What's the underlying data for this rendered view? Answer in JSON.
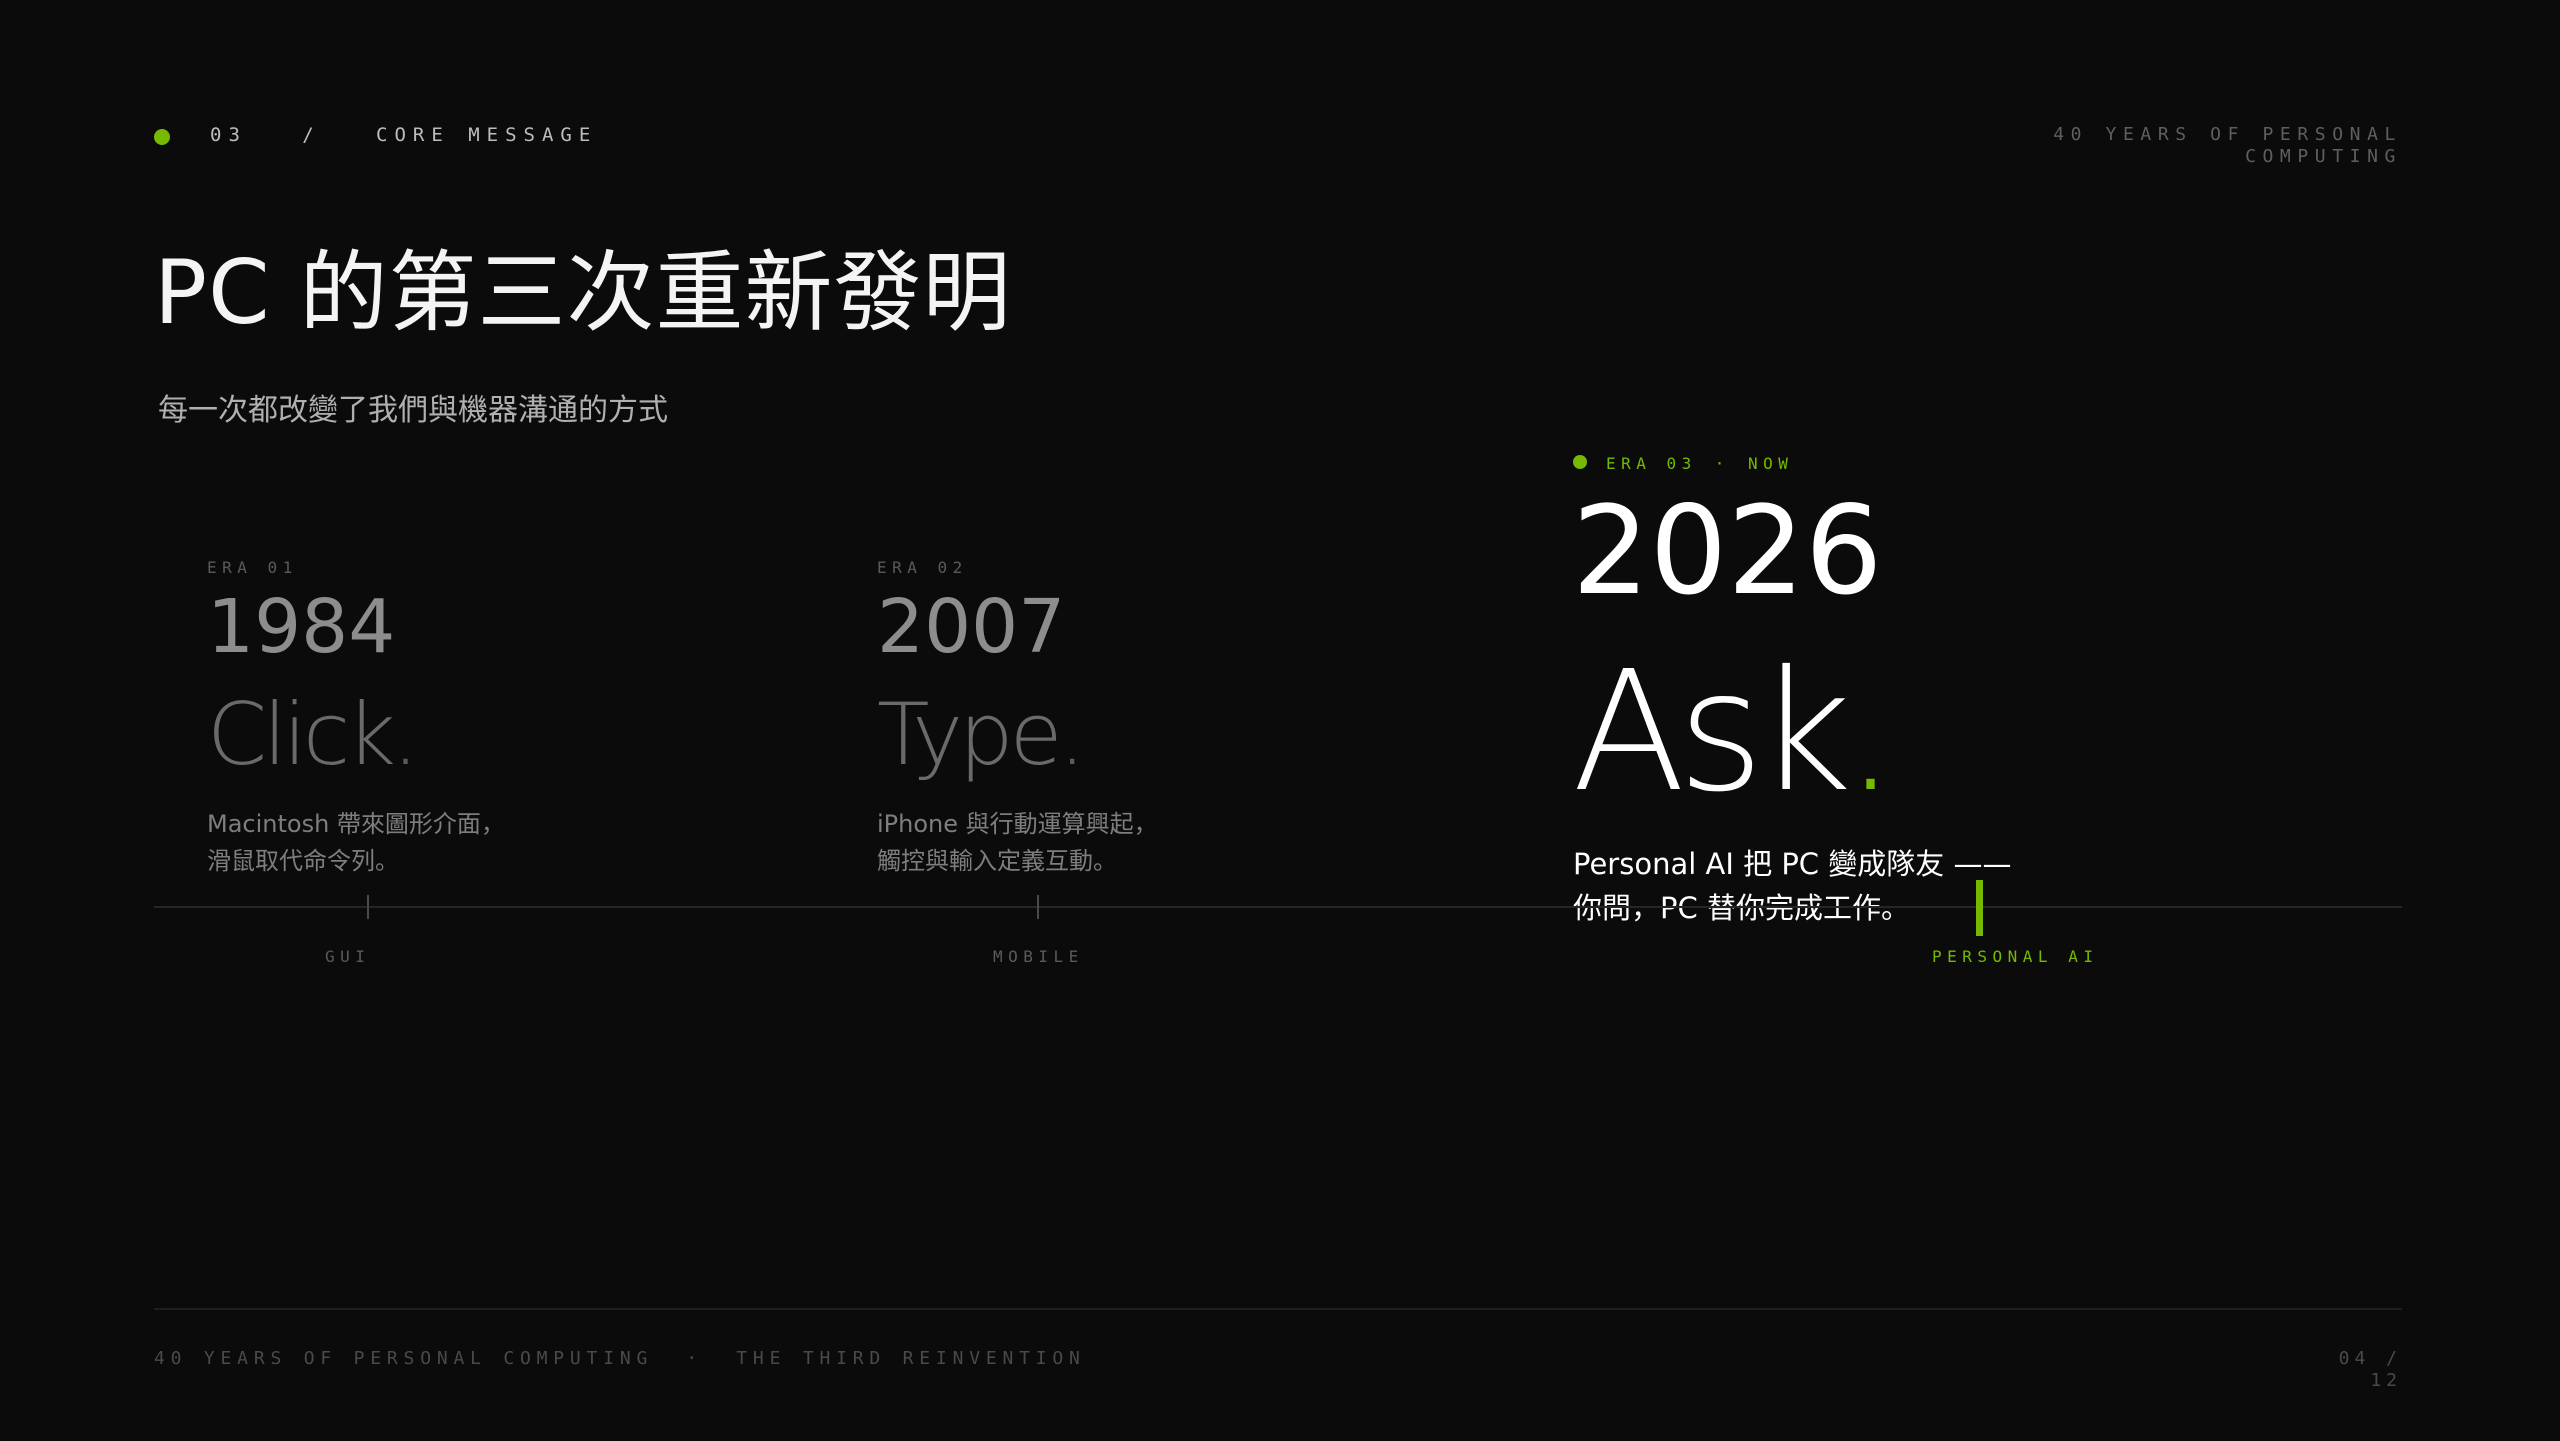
{
  "header": {
    "section_number": "03",
    "separator": "/",
    "section_label": "CORE MESSAGE",
    "deck_title_line1": "40 YEARS OF PERSONAL",
    "deck_title_line2": "COMPUTING"
  },
  "title": "PC 的第三次重新發明",
  "subtitle": "每一次都改變了我們與機器溝通的方式",
  "eras": [
    {
      "caption": "ERA 01",
      "year": "1984",
      "verb": "Click",
      "period": ".",
      "desc_line1": "Macintosh 帶來圖形介面，",
      "desc_line2": "滑鼠取代命令列。",
      "axis_label": "GUI"
    },
    {
      "caption": "ERA 02",
      "year": "2007",
      "verb": "Type",
      "period": ".",
      "desc_line1": "iPhone 與行動運算興起，",
      "desc_line2": "觸控與輸入定義互動。",
      "axis_label": "MOBILE"
    }
  ],
  "current_era": {
    "caption": "ERA 03",
    "dot_sep": "·",
    "now_label": "NOW",
    "year": "2026",
    "verb": "Ask",
    "period": ".",
    "desc_line1": "Personal AI 把 PC 變成隊友 ——",
    "desc_line2": "你問，PC 替你完成工作。",
    "axis_label": "PERSONAL AI"
  },
  "footer": {
    "text": "40 YEARS OF PERSONAL COMPUTING  ·  THE THIRD REINVENTION",
    "page_current": "04 /",
    "page_total": "12"
  },
  "colors": {
    "accent": "#76b900",
    "background": "#0b0b0c"
  }
}
